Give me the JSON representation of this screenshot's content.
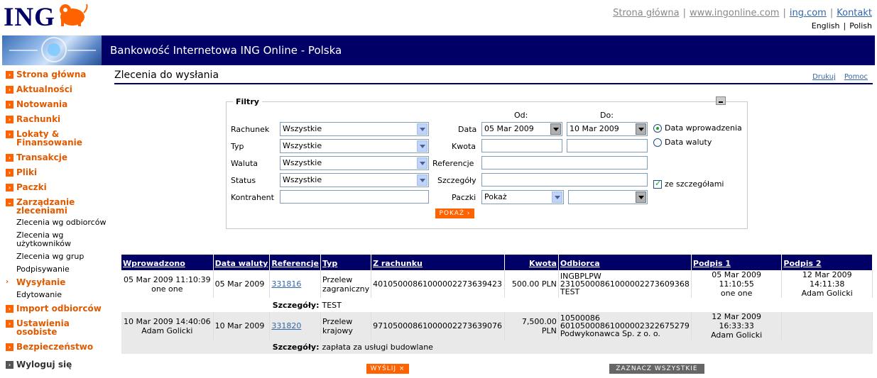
{
  "brand": {
    "name": "ING"
  },
  "toplinks": [
    "Strona główna",
    "www.ingonline.com",
    "ing.com",
    "Kontakt"
  ],
  "languages": [
    "English",
    "Polish"
  ],
  "banner_title": "Bankowość Internetowa ING Online - Polska",
  "sidenav": {
    "items": [
      "Strona główna",
      "Aktualności",
      "Notowania",
      "Rachunki",
      "Lokaty & Finansowanie",
      "Transakcje",
      "Pliki",
      "Paczki",
      "Zarządzanie zleceniami"
    ],
    "sub_items": [
      "Zlecenia wg odbiorców",
      "Zlecenia wg użytkowników",
      "Zlecenia wg grup",
      "Podpisywanie"
    ],
    "active": "Wysyłanie",
    "active_sub": "Edytowanie",
    "items_after": [
      "Import odbiorców",
      "Ustawienia osobiste",
      "Bezpieczeństwo"
    ],
    "logout": "Wyloguj się"
  },
  "page": {
    "title": "Zlecenia do wysłania",
    "print": "Drukuj",
    "help": "Pomoc"
  },
  "filters": {
    "legend": "Filtry",
    "labels": {
      "account": "Rachunek",
      "type": "Typ",
      "currency": "Waluta",
      "status": "Status",
      "contractor": "Kontrahent",
      "date": "Data",
      "amount": "Kwota",
      "references": "Referencje",
      "details": "Szczegóły",
      "packages": "Paczki",
      "from": "Od:",
      "to": "Do:"
    },
    "account_value": "Wszystkie",
    "type_value": "Wszystkie",
    "currency_value": "Wszystkie",
    "status_value": "Wszystkie",
    "date_from": "05 Mar 2009",
    "date_to": "10 Mar 2009",
    "packages_value": "Pokaż",
    "radio_entry": "Data wprowadzenia",
    "radio_currency": "Data waluty",
    "with_details": "ze szczegółami",
    "show_button": "POKAŻ ›"
  },
  "table": {
    "headers": [
      "Wprowadzono",
      "Data waluty",
      "Referencje",
      "Typ",
      "Z rachunku",
      "Kwota",
      "Odbiorca",
      "Podpis 1",
      "Podpis 2"
    ],
    "details_label": "Szczegóły:",
    "rows": [
      {
        "entered_date": "05 Mar 2009 11:10:39",
        "entered_by": "one one",
        "value_date": "05 Mar 2009",
        "ref": "331816",
        "type_l1": "Przelew",
        "type_l2": "zagraniczny",
        "from_account": "40105000861000002273639423",
        "amount": "500.00 PLN",
        "recipient_l1": "INGBPLPW",
        "recipient_l2": "23105000861000002273609368",
        "recipient_l3": "TEST",
        "sig1_date": "05 Mar 2009 11:10:55",
        "sig1_by": "one one",
        "sig2_date": "12 Mar 2009 14:11:38",
        "sig2_by": "Adam Golicki",
        "details": "TEST"
      },
      {
        "entered_date": "10 Mar 2009 14:40:06",
        "entered_by": "Adam Golicki",
        "value_date": "10 Mar 2009",
        "ref": "331820",
        "type_l1": "Przelew",
        "type_l2": "krajowy",
        "from_account": "97105000861000002273639076",
        "amount": "7,500.00 PLN",
        "recipient_l1": "10500086",
        "recipient_l2": "60105000861000002322675279",
        "recipient_l3": "Podwykonawca Sp. z o. o.",
        "sig1_date": "12 Mar 2009 16:33:33",
        "sig1_by": "Adam Golicki",
        "sig2_date": "",
        "sig2_by": "",
        "details": "zapłata za usługi budowlane"
      }
    ]
  },
  "actions": {
    "send": "WYŚLIJ ×",
    "select_all": "ZAZNACZ WSZYSTKIE"
  },
  "colors": {
    "navy": "#000066",
    "orange": "#ff6200",
    "link": "#3366aa"
  }
}
